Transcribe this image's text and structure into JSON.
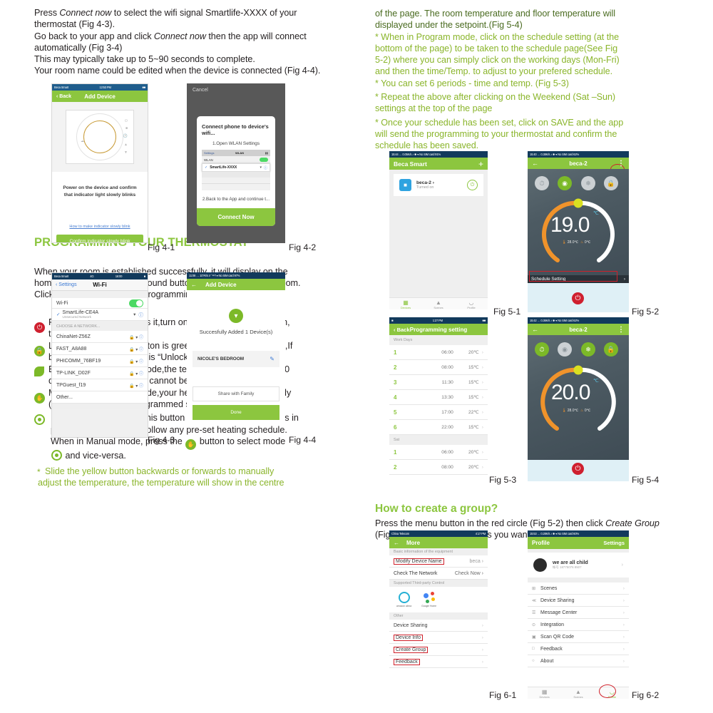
{
  "left_column": {
    "intro_paragraph": [
      {
        "t": "Press ",
        "s": "n"
      },
      {
        "t": "Connect now",
        "s": "i"
      },
      {
        "t": " to select the wifi signal Smartlife-XXXX of your",
        "s": "n"
      }
    ],
    "intro_lines": [
      "thermostat   (Fig 4-3).",
      "Go back to your app and click Connect now then the app will connect",
      "automatically (Fig 3-4)",
      "This may typically take up to 5~90 seconds to complete.",
      "Your room name could be edited when the device is connected (Fig 4-4)."
    ],
    "section_title": "PROGRAMMING YOUR THERMOSTAT",
    "section_paragraph": [
      "When your room is established successfully, it will display on the",
      "home screen (Fig 5-1). The round button is to turn on/off your room.",
      "Click the line into begening programming your thermostat."
    ],
    "bullets": [
      {
        "icon": "power-icon",
        "icon_color": "#cf202f",
        "lines": [
          "Power on/off button,press it,turn on the device,press it again,",
          "turn off the device"
        ]
      },
      {
        "icon": "lock-icon",
        "icon_color": "#7cb928",
        "lines": [
          "Lock/Unlock button.If button is green,the screen is “Locked”,If",
          "button is grey,the screen is “Unlocked”."
        ]
      },
      {
        "icon": "leaf-icon",
        "icon_color": "#7cb928",
        "lines": [
          "Econony button,in this mode,the temperature will be keep 20",
          "degree.This temperature cannot be changed or adjusted."
        ]
      },
      {
        "icon": "hand-icon",
        "icon_color": "#7cb928",
        "lines": [
          "Manual button:In this mode,your heating can be set manually",
          "(ie.Not using the pre-programmed settings)"
        ]
      },
      {
        "icon": "program-icon",
        "icon_color": "#7cb928",
        "lines": [
          "Program button. When this button shows, your thermostat is in",
          "program mode and will follow any pre-set heating schedule.",
          "When in Manual mode, press the",
          "and vice-versa."
        ],
        "inline_mid": "button to select mode"
      }
    ],
    "footnote": [
      "Slide the yellow button backwards or forwards to manually",
      "adjust the temperature, the temperature will show in the centre"
    ]
  },
  "right_column": {
    "top_note_dark": [
      "of the page. The room temperature and floor temperature will",
      "displayed under the setpoint.(Fig 5-4)"
    ],
    "top_note_green": [
      "* When in Program mode, click on the schedule setting (at the",
      "bottom of the page) to be taken to the schedule page(See Fig",
      "5-2) where you can simply click on the working days (Mon-Fri)",
      "and then the time/Temp. to adjust to your prefered schedule.",
      "*  You can set 6 periods - time and temp.  (Fig 5-3)",
      "*  Repeat the above after clicking on the Weekend (Sat –Sun)",
      "settings at the top of the page",
      "* Once your schedule has been set, click on SAVE and the app",
      " will send the programming to your thermostat and confirm the",
      "schedule has been saved."
    ],
    "group_title": "How to create a group?",
    "group_paragraph": [
      "Press the menu button in the red circle (Fig 5-2) then  click Create Group",
      "(Fig 6-1). Select all the rooms you want and confirm."
    ]
  },
  "captions": {
    "fig41": "Fig 4-1",
    "fig42": "Fig 4-2",
    "fig43": "Fig 4-3",
    "fig44": "Fig 4-4",
    "fig51": "Fig 5-1",
    "fig52": "Fig 5-2",
    "fig53": "Fig 5-3",
    "fig54": "Fig 5-4",
    "fig61": "Fig 6-1",
    "fig62": "Fig 6-2"
  },
  "fig41": {
    "status_left": "Beca Smart",
    "status_center": "12:53 PM",
    "nav_back": "‹ Back",
    "nav_title": "Add Device",
    "instruction_l1": "Power on the device and confirm",
    "instruction_l2": "that indicator light slowly blinks",
    "link": "How to make indicator slowly blink",
    "button": "Confirm indicator slowly blink"
  },
  "fig42": {
    "cancel": "Cancel",
    "dialog_title": "Connect phone to device's wifi...",
    "step1": "1.Open WLAN Settings",
    "mini_settings": "Settings",
    "mini_wlan": "WLAN",
    "mini_wlan_row": "WLAN",
    "ssid": "SmartLife-XXXX",
    "step2": "2.Back to the App and continue t...",
    "button": "Connect Now"
  },
  "fig43": {
    "status_left": "Beca Smart",
    "status_net": "4G",
    "status_time": "16:00",
    "nav_back": "‹ Settings",
    "nav_title": "Wi-Fi",
    "wifi_row": "Wi-Fi",
    "connected_ssid": "SmartLife-CE4A",
    "connected_sub": "Unsecured Network",
    "choose_header": "CHOOSE A NETWORK...",
    "networks": [
      "ChinaNet-Z56Z",
      "FAST_A8A88",
      "PHICOMM_76BF19",
      "TP-LINK_D02F",
      "TPGuest_f19",
      "Other..."
    ]
  },
  "fig44": {
    "status": "11:08 … 10?K/s ⫻ ༺ ▾ No SIM card  97%",
    "nav_title": "Add Device",
    "success_text": "Succesfully Added 1 Device(s)",
    "room_name": "NICOLE'S BEDROOM",
    "share_button": "Share with Family",
    "done_button": "Done"
  },
  "fig51": {
    "status": "15:44 … 0.05K/s ♪ ✱ ▾ No SIM card  91%",
    "nav_title": "Beca Smart",
    "add_icon": "+",
    "device_name": "beca-2 ›",
    "device_state": "Turned on",
    "tabs": [
      "Devices",
      "Scenes",
      "Profile"
    ]
  },
  "fig52": {
    "status": "15:40 … 0.38K/s ♪ ✱ ▾ No SIM card  62%",
    "nav_title": "beca-2",
    "menu_icon": "⋮",
    "setpoint": "19.0",
    "unit": "℃",
    "room_temp": "28.0℃",
    "floor_temp": "0℃",
    "schedule_label": "Schedule Setting",
    "modes": [
      "clock-mode",
      "program-mode",
      "eco-mode",
      "lock-mode"
    ],
    "active_mode_index": 1
  },
  "fig53": {
    "status": "1:27 PM",
    "nav_back": "‹ Back",
    "nav_title": "Programming setting",
    "workdays_header": "Work Days",
    "workdays": [
      {
        "n": "1",
        "time": "06:00",
        "temp": "20℃"
      },
      {
        "n": "2",
        "time": "08:00",
        "temp": "15℃"
      },
      {
        "n": "3",
        "time": "11:30",
        "temp": "15℃"
      },
      {
        "n": "4",
        "time": "13:30",
        "temp": "15℃"
      },
      {
        "n": "5",
        "time": "17:00",
        "temp": "22℃"
      },
      {
        "n": "6",
        "time": "22:00",
        "temp": "15℃"
      }
    ],
    "sat_header": "Sat",
    "sat": [
      {
        "n": "1",
        "time": "06:00",
        "temp": "20℃"
      },
      {
        "n": "2",
        "time": "08:00",
        "temp": "20℃"
      }
    ]
  },
  "fig54": {
    "status": "15:42 … 0.36K/s ♪ ✱ ▾ No SIM card  62%",
    "nav_title": "beca-2",
    "menu_icon": "⋮",
    "setpoint": "20.0",
    "unit": "℃",
    "room_temp": "28.0℃",
    "floor_temp": "0℃",
    "modes": [
      "clock-mode",
      "program-mode",
      "eco-mode",
      "lock-mode"
    ],
    "active_mode_index": 0
  },
  "fig61": {
    "status_left": "China Telecom",
    "status_right": "4:17 PM",
    "nav_title": "More",
    "section1": "Basic information of the equipment",
    "modify_label": "Modify Device Name",
    "modify_value": "beca ›",
    "network_label": "Check The Network",
    "network_value": "Check Now ›",
    "section2": "Supported Third-party Control",
    "third_party": [
      "amazon alexa",
      "Google Home"
    ],
    "section3": "Other",
    "items": [
      "Device Sharing",
      "Device Info",
      "Create Group",
      "Feedback"
    ]
  },
  "fig62": {
    "status": "15:53 … 0.28K/s ♪ ✱ ▾ No SIM card  60%",
    "nav_title": "Profile",
    "settings_label": "Settings",
    "user_name": "we are all child",
    "user_id": "帐号 18775076 8507",
    "items": [
      "Scenes",
      "Device Sharing",
      "Message Center",
      "Integration",
      "Scan QR Code",
      "Feedback",
      "About"
    ],
    "tabs": [
      "Devices",
      "Scenes",
      "Profile"
    ]
  },
  "colors": {
    "brand_green": "#8cc63f",
    "text_green": "#8ab52b",
    "red": "#cf202f",
    "status_blue": "#1f5d8c"
  }
}
